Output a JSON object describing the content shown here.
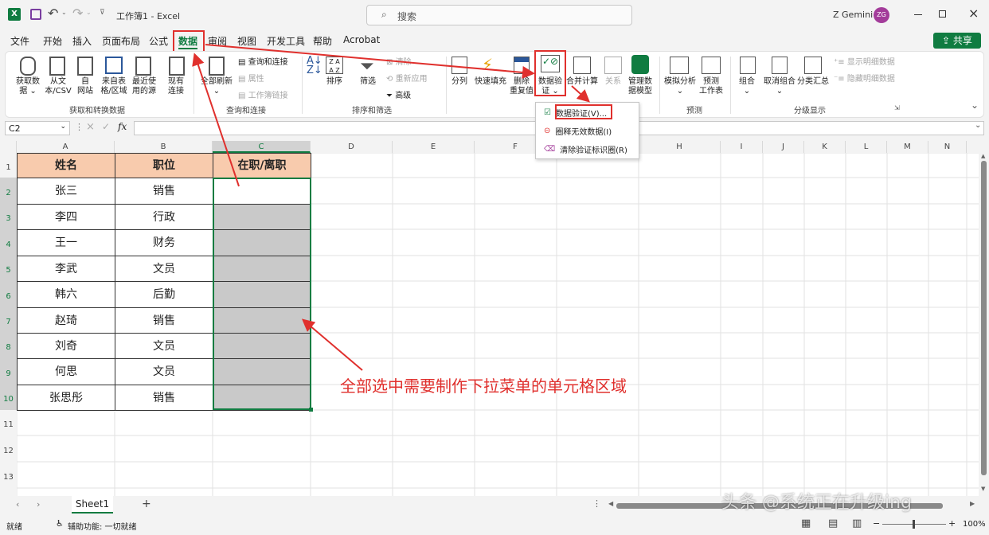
{
  "title_bar": {
    "doc_title": "工作簿1 - Excel",
    "search_placeholder": "搜索",
    "user_name": "Z Gemini",
    "user_initials": "ZG",
    "share_label": "共享"
  },
  "menu": [
    "文件",
    "开始",
    "插入",
    "页面布局",
    "公式",
    "数据",
    "审阅",
    "视图",
    "开发工具",
    "帮助",
    "Acrobat"
  ],
  "ribbon": {
    "get_data": {
      "btn1": "获取数据",
      "btn2_l1": "从文",
      "btn2_l2": "本/CSV",
      "btn3_l1": "自",
      "btn3_l2": "网站",
      "btn4_l1": "来自表",
      "btn4_l2": "格/区域",
      "btn5_l1": "最近使",
      "btn5_l2": "用的源",
      "btn6_l1": "现有",
      "btn6_l2": "连接",
      "label": "获取和转换数据"
    },
    "queries": {
      "refresh_l1": "全部刷新",
      "queries_conn": "查询和连接",
      "properties": "属性",
      "workbook_links": "工作簿链接",
      "label": "查询和连接"
    },
    "sort": {
      "sort": "排序",
      "filter": "筛选",
      "clear": "清除",
      "reapply": "重新应用",
      "advanced": "高级",
      "label": "排序和筛选"
    },
    "tools": {
      "split": "分列",
      "flash": "快速填充",
      "remove_l1": "删除",
      "remove_l2": "重复值",
      "validation_l1": "数据验",
      "validation_l2": "证",
      "consolidate": "合并计算",
      "relations": "关系",
      "model_l1": "管理数",
      "model_l2": "据模型"
    },
    "forecast": {
      "whatif": "模拟分析",
      "sheet_l1": "预测",
      "sheet_l2": "工作表",
      "label": "预测"
    },
    "outline": {
      "group": "组合",
      "ungroup": "取消组合",
      "subtotal": "分类汇总",
      "show": "显示明细数据",
      "hide": "隐藏明细数据",
      "label": "分级显示"
    }
  },
  "dropdown": [
    "数据验证(V)...",
    "圈释无效数据(I)",
    "清除验证标识圈(R)"
  ],
  "formula_bar": {
    "name_box": "C2",
    "formula": ""
  },
  "columns": [
    "A",
    "B",
    "C",
    "D",
    "E",
    "F",
    "G",
    "H",
    "I",
    "J",
    "K",
    "L",
    "M",
    "N"
  ],
  "rows": [
    "1",
    "2",
    "3",
    "4",
    "5",
    "6",
    "7",
    "8",
    "9",
    "10",
    "11",
    "12",
    "13"
  ],
  "table": {
    "headers": [
      "姓名",
      "职位",
      "在职/离职"
    ],
    "names": [
      "张三",
      "李四",
      "王一",
      "李武",
      "韩六",
      "赵琦",
      "刘奇",
      "何思",
      "张思彤"
    ],
    "positions": [
      "销售",
      "行政",
      "财务",
      "文员",
      "后勤",
      "销售",
      "文员",
      "文员",
      "销售"
    ]
  },
  "annotation": "全部选中需要制作下拉菜单的单元格区域",
  "sheet_tab": "Sheet1",
  "status": {
    "ready": "就绪",
    "accessibility": "辅助功能: 一切就绪",
    "zoom": "100%",
    "watermark": "头条 @系统正在升级ing"
  },
  "colors": {
    "header_fill": "#f8cbad",
    "selection_fill": "#c9c9c9",
    "accent": "#107c41",
    "annotation": "#e0302d"
  }
}
